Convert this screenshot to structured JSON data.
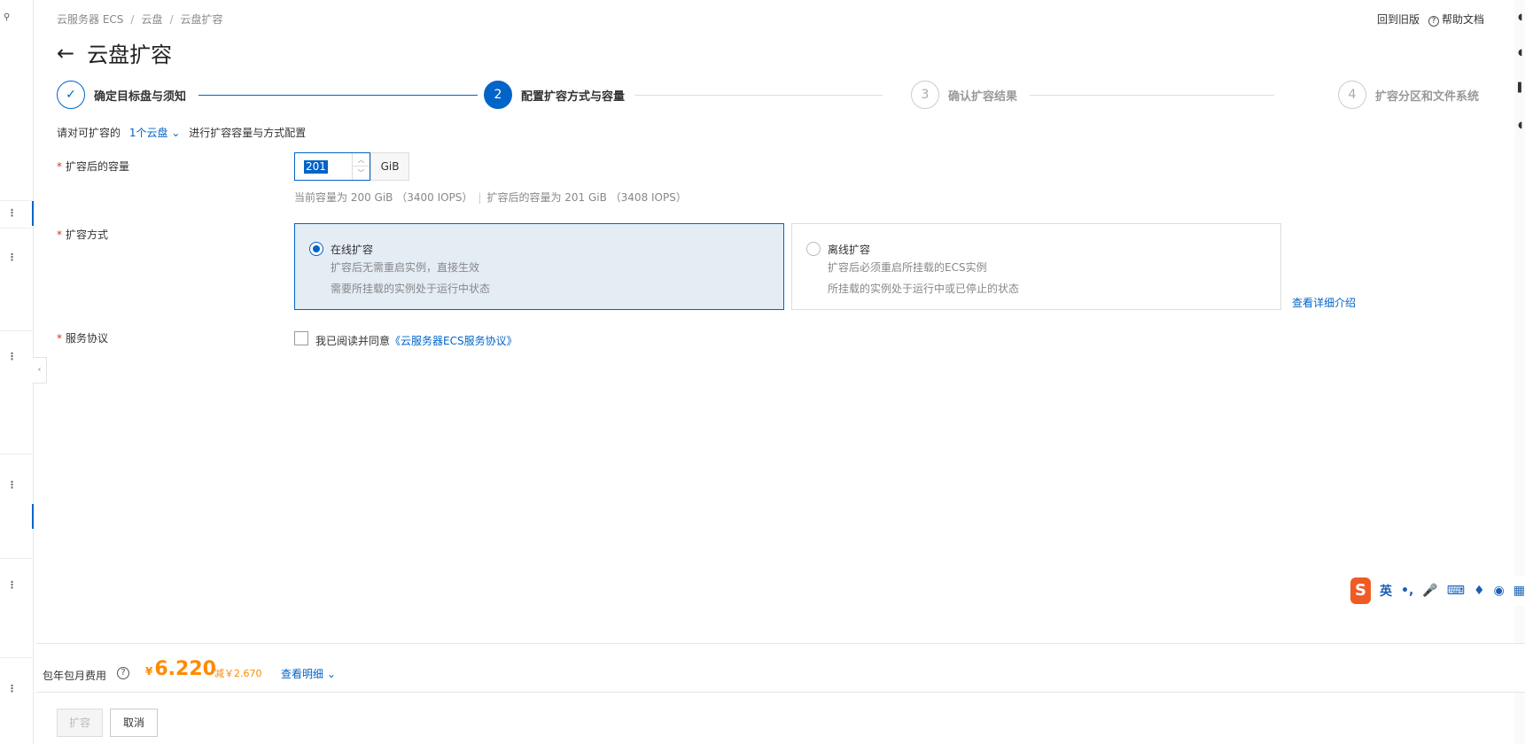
{
  "breadcrumb": [
    "云服务器 ECS",
    "云盘",
    "云盘扩容"
  ],
  "top_links": {
    "old_version": "回到旧版",
    "help": "帮助文档"
  },
  "page": {
    "title": "云盘扩容",
    "back_icon": "arrow-left-icon"
  },
  "steps": [
    {
      "index": "1",
      "label": "确定目标盘与须知",
      "state": "done"
    },
    {
      "index": "2",
      "label": "配置扩容方式与容量",
      "state": "active"
    },
    {
      "index": "3",
      "label": "确认扩容结果",
      "state": "pending"
    },
    {
      "index": "4",
      "label": "扩容分区和文件系统",
      "state": "pending"
    }
  ],
  "note": {
    "prefix": "请对可扩容的",
    "link": "1个云盘",
    "suffix": "进行扩容容量与方式配置"
  },
  "capacity": {
    "label": "扩容后的容量",
    "value": "201",
    "unit": "GiB",
    "current": "当前容量为 200 GiB （3400 IOPS）",
    "after": "扩容后的容量为 201 GiB （3408 IOPS）"
  },
  "method": {
    "label": "扩容方式",
    "options": [
      {
        "title": "在线扩容",
        "line1": "扩容后无需重启实例，直接生效",
        "line2": "需要所挂载的实例处于运行中状态",
        "selected": true
      },
      {
        "title": "离线扩容",
        "line1": "扩容后必须重启所挂载的ECS实例",
        "line2": "所挂载的实例处于运行中或已停止的状态",
        "selected": false
      }
    ],
    "detail_link": "查看详细介绍"
  },
  "agreement": {
    "label": "服务协议",
    "text": "我已阅读并同意",
    "link": "《云服务器ECS服务协议》",
    "checked": false
  },
  "ime": {
    "lang": "英",
    "punct": "•,",
    "mic": "🎤",
    "keyboard": "⌨"
  },
  "footer": {
    "fee_label": "包年包月费用",
    "currency": "¥",
    "amount": "6.220",
    "discount": "减￥2.670",
    "view_detail": "查看明细"
  },
  "buttons": {
    "expand": "扩容",
    "cancel": "取消"
  },
  "colors": {
    "primary": "#0064c8",
    "price": "#ff8a00",
    "required": "#e0301e"
  }
}
